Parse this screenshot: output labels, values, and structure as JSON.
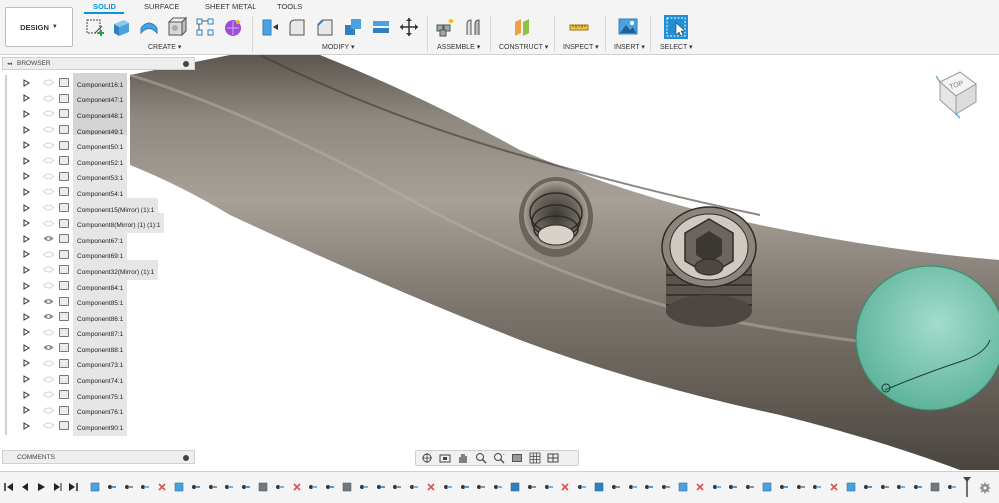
{
  "workspace": {
    "label": "DESIGN"
  },
  "tabs": [
    {
      "label": "SOLID",
      "active": true
    },
    {
      "label": "SURFACE",
      "active": false
    },
    {
      "label": "SHEET METAL",
      "active": false
    },
    {
      "label": "TOOLS",
      "active": false
    }
  ],
  "groups": {
    "create": "CREATE",
    "modify": "MODIFY",
    "assemble": "ASSEMBLE",
    "construct": "CONSTRUCT",
    "inspect": "INSPECT",
    "insert": "INSERT",
    "select": "SELECT"
  },
  "browser": {
    "title": "BROWSER",
    "items": [
      {
        "label": "Component16:1",
        "visible": false,
        "highlighted": true
      },
      {
        "label": "Component47:1",
        "visible": false,
        "highlighted": true
      },
      {
        "label": "Component48:1",
        "visible": false,
        "highlighted": true
      },
      {
        "label": "Component49:1",
        "visible": false,
        "highlighted": true
      },
      {
        "label": "Component50:1",
        "visible": false,
        "highlighted": false
      },
      {
        "label": "Component52:1",
        "visible": false,
        "highlighted": false
      },
      {
        "label": "Component53:1",
        "visible": false,
        "highlighted": false
      },
      {
        "label": "Component54:1",
        "visible": false,
        "highlighted": false
      },
      {
        "label": "Component15(Mirror) (1):1",
        "visible": false,
        "highlighted": false
      },
      {
        "label": "Component8(Mirror) (1) (1):1",
        "visible": false,
        "highlighted": false
      },
      {
        "label": "Component67:1",
        "visible": true,
        "highlighted": false
      },
      {
        "label": "Component69:1",
        "visible": false,
        "highlighted": false
      },
      {
        "label": "Component32(Mirror) (1):1",
        "visible": false,
        "highlighted": false
      },
      {
        "label": "Component84:1",
        "visible": false,
        "highlighted": false
      },
      {
        "label": "Component85:1",
        "visible": true,
        "highlighted": false
      },
      {
        "label": "Component86:1",
        "visible": true,
        "highlighted": false
      },
      {
        "label": "Component87:1",
        "visible": false,
        "highlighted": false
      },
      {
        "label": "Component88:1",
        "visible": true,
        "highlighted": false
      },
      {
        "label": "Component73:1",
        "visible": false,
        "highlighted": false
      },
      {
        "label": "Component74:1",
        "visible": false,
        "highlighted": false
      },
      {
        "label": "Component75:1",
        "visible": false,
        "highlighted": false
      },
      {
        "label": "Component76:1",
        "visible": false,
        "highlighted": false
      },
      {
        "label": "Component90:1",
        "visible": false,
        "highlighted": false
      }
    ]
  },
  "comments": {
    "title": "COMMENTS"
  },
  "viewcube": {
    "face": "TOP"
  },
  "colors": {
    "accent": "#0696d7",
    "body": "#7f786f",
    "selected_face": "#6fbfa8"
  }
}
